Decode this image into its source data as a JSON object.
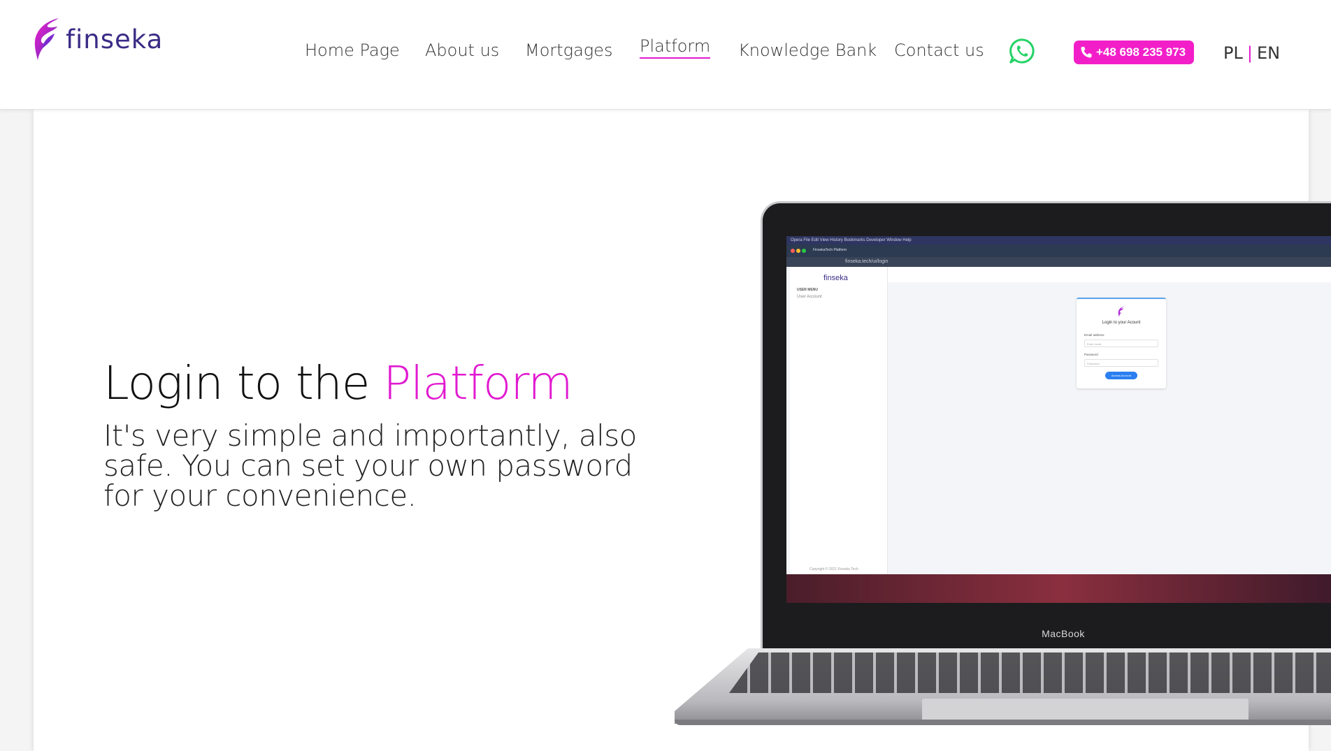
{
  "brand": {
    "name": "finseka",
    "logo_icon": "feather-logo-icon",
    "accent_color": "#e11ad0"
  },
  "nav": {
    "items": [
      {
        "label": "Home Page"
      },
      {
        "label": "About us"
      },
      {
        "label": "Mortgages"
      },
      {
        "label": "Platform",
        "active": true
      },
      {
        "label": "Knowledge Bank"
      },
      {
        "label": "Contact us"
      }
    ],
    "whatsapp_icon": "whatsapp-icon",
    "phone": {
      "label": "+48 698 235 973",
      "icon": "phone-icon",
      "color": "#f21fc9"
    },
    "languages": {
      "pl": "PL",
      "separator": "|",
      "en": "EN"
    }
  },
  "hero": {
    "title_prefix": "Login to the",
    "title_accent": "Platform",
    "text": "It's very simple and importantly, also safe. You can set your own password for your convenience."
  },
  "laptop": {
    "label": "MacBook",
    "screen": {
      "menubar": "Opera   File   Edit   View   History   Bookmarks   Developer   Window   Help",
      "tab": "FinsekaTech Platform",
      "url": "finseka.tech/ui/login",
      "sidebar_logo": "finseka",
      "sidebar_menu_title": "USER MENU",
      "sidebar_item": "User Account",
      "copyright": "Copyright © 2021 Finseka Tech",
      "login_title": "Login to your Acount",
      "email_label": "Email address",
      "email_placeholder": "Enter email",
      "password_label": "Password",
      "password_placeholder": "Password",
      "button_label": "Access Account"
    }
  }
}
